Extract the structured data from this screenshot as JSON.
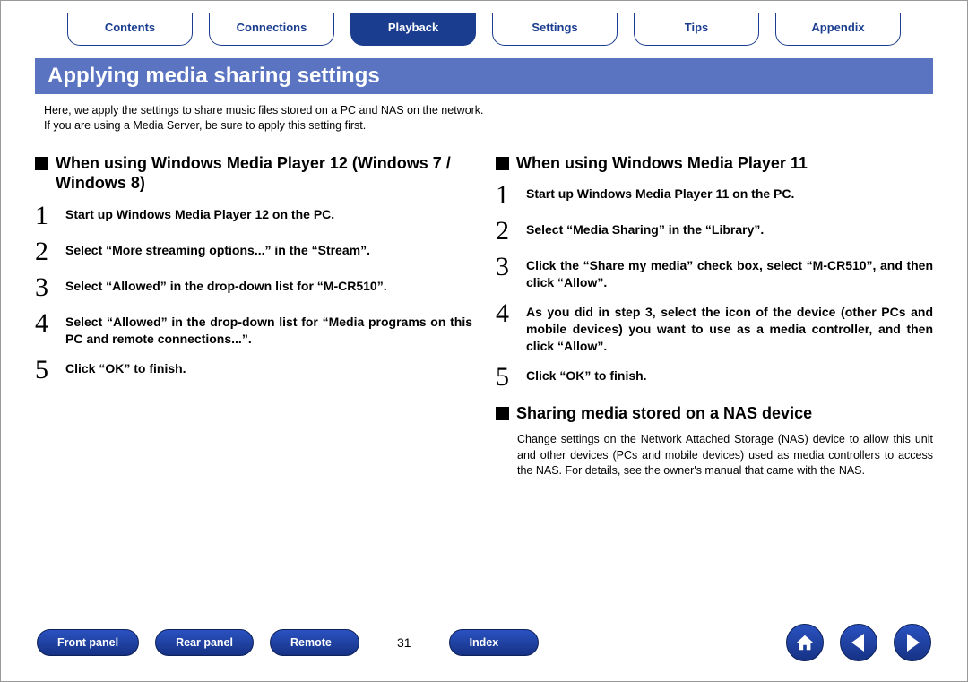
{
  "nav": {
    "tabs": [
      {
        "label": "Contents",
        "active": false
      },
      {
        "label": "Connections",
        "active": false
      },
      {
        "label": "Playback",
        "active": true
      },
      {
        "label": "Settings",
        "active": false
      },
      {
        "label": "Tips",
        "active": false
      },
      {
        "label": "Appendix",
        "active": false
      }
    ]
  },
  "title": "Applying media sharing settings",
  "intro_line1": "Here, we apply the settings to share music files stored on a PC and NAS on the network.",
  "intro_line2": "If you are using a Media Server, be sure to apply this setting first.",
  "left": {
    "heading": "When using Windows Media Player 12 (Windows 7 / Windows 8)",
    "steps": [
      "Start up Windows Media Player 12 on the PC.",
      "Select “More streaming options...” in the “Stream”.",
      "Select “Allowed” in the drop-down list for “M-CR510”.",
      "Select “Allowed” in the drop-down list for “Media programs on this PC and remote connections...”.",
      "Click “OK” to finish."
    ]
  },
  "right": {
    "heading1": "When using Windows Media Player 11",
    "steps": [
      "Start up Windows Media Player 11 on the PC.",
      "Select “Media Sharing” in the “Library”.",
      "Click the “Share my media” check box, select “M-CR510”, and then click “Allow”.",
      "As you did in step 3, select the icon of the device (other PCs and mobile devices) you want to use as a media controller, and then click “Allow”.",
      "Click “OK” to finish."
    ],
    "heading2": "Sharing media stored on a NAS device",
    "nas_note": "Change settings on the Network Attached Storage (NAS) device to allow this unit and other devices (PCs and mobile devices) used as media controllers to access the NAS. For details, see the owner's manual that came with the NAS."
  },
  "footer": {
    "pills": [
      "Front panel",
      "Rear panel",
      "Remote",
      "Index"
    ],
    "page": "31"
  }
}
